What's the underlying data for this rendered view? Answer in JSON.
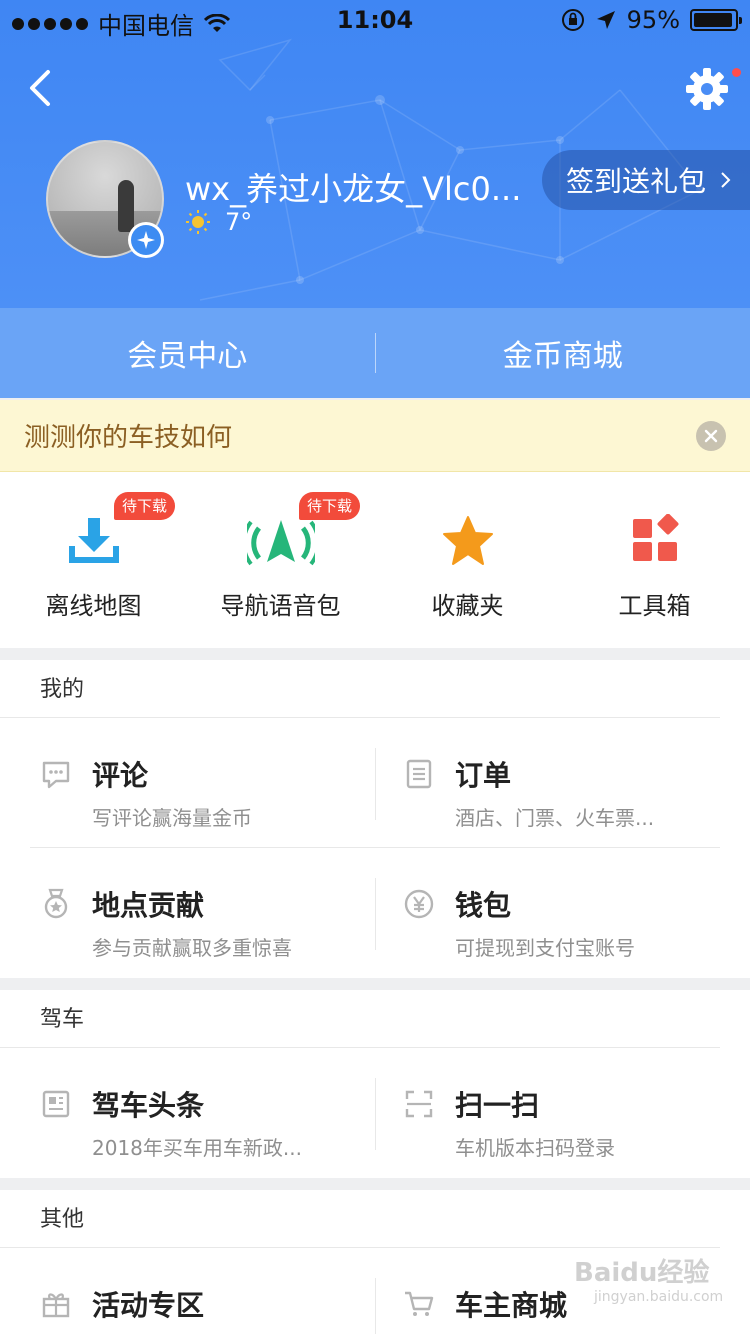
{
  "status_bar": {
    "carrier": "中国电信",
    "time": "11:04",
    "battery": "95%"
  },
  "profile": {
    "username": "wx_养过小龙女_Vlc0...",
    "temperature": "7°",
    "signin_label": "签到送礼包"
  },
  "member_bar": {
    "left": "会员中心",
    "right": "金币商城"
  },
  "notice": {
    "text": "测测你的车技如何"
  },
  "quick_actions": [
    {
      "label": "离线地图",
      "tag": "待下载",
      "icon": "download-icon"
    },
    {
      "label": "导航语音包",
      "tag": "待下载",
      "icon": "navigation-voice-icon"
    },
    {
      "label": "收藏夹",
      "icon": "star-icon"
    },
    {
      "label": "工具箱",
      "icon": "toolbox-icon"
    }
  ],
  "sections": [
    {
      "title": "我的",
      "items": [
        {
          "title": "评论",
          "subtitle": "写评论赢海量金币",
          "icon": "comment-icon"
        },
        {
          "title": "订单",
          "subtitle": "酒店、门票、火车票...",
          "icon": "order-icon"
        },
        {
          "title": "地点贡献",
          "subtitle": "参与贡献赢取多重惊喜",
          "icon": "medal-icon"
        },
        {
          "title": "钱包",
          "subtitle": "可提现到支付宝账号",
          "icon": "wallet-icon"
        }
      ]
    },
    {
      "title": "驾车",
      "items": [
        {
          "title": "驾车头条",
          "subtitle": "2018年买车用车新政...",
          "icon": "news-icon"
        },
        {
          "title": "扫一扫",
          "subtitle": "车机版本扫码登录",
          "icon": "scan-icon"
        }
      ]
    },
    {
      "title": "其他",
      "items": [
        {
          "title": "活动专区",
          "icon": "gift-icon"
        },
        {
          "title": "车主商城",
          "icon": "cart-icon"
        }
      ]
    }
  ],
  "watermark": {
    "brand": "Baidu经验",
    "url": "jingyan.baidu.com"
  },
  "colors": {
    "header_blue": "#4a8df5",
    "tag_red": "#f24b3b",
    "notice_bg": "#fdf7d3"
  }
}
